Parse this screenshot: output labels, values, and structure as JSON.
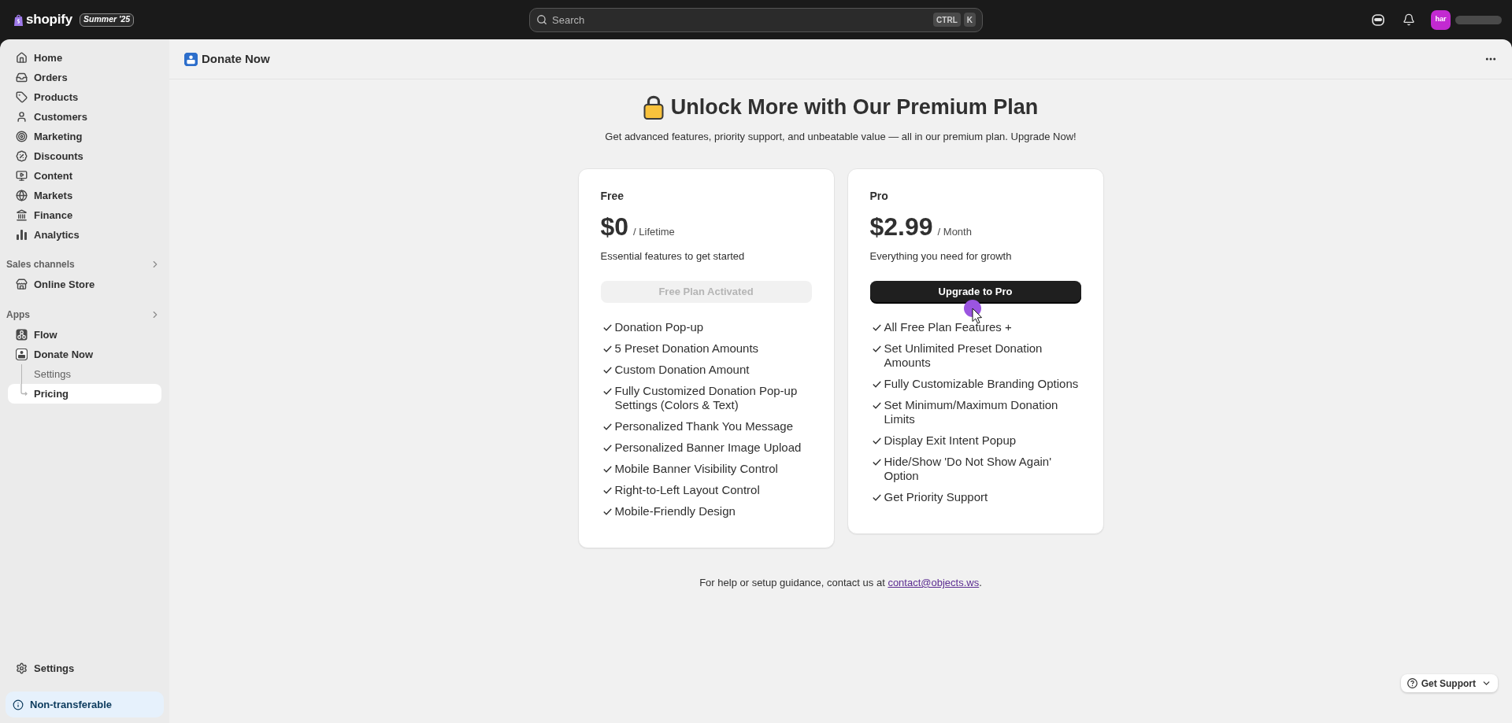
{
  "top_bar": {
    "logo": "shopify",
    "badge": "Summer '25",
    "search": {
      "placeholder": "Search",
      "shortcut_keys": [
        "CTRL",
        "K"
      ]
    },
    "avatar": "har"
  },
  "sidebar": {
    "main_items": [
      {
        "label": "Home",
        "selected": false
      },
      {
        "label": "Orders",
        "selected": false
      },
      {
        "label": "Products",
        "selected": false
      },
      {
        "label": "Customers",
        "selected": false
      },
      {
        "label": "Marketing",
        "selected": false
      },
      {
        "label": "Discounts",
        "selected": false
      },
      {
        "label": "Content",
        "selected": false
      },
      {
        "label": "Markets",
        "selected": false
      },
      {
        "label": "Finance",
        "selected": false
      },
      {
        "label": "Analytics",
        "selected": false
      }
    ],
    "sections": [
      {
        "title": "Sales channels",
        "items": [
          {
            "label": "Online Store",
            "selected": false
          }
        ]
      },
      {
        "title": "Apps",
        "items": [
          {
            "label": "Flow",
            "selected": false
          },
          {
            "label": "Donate Now",
            "selected": false,
            "children": [
              {
                "label": "Settings",
                "selected": false
              },
              {
                "label": "Pricing",
                "selected": true
              }
            ]
          }
        ]
      }
    ],
    "bottom_items": [
      {
        "label": "Settings",
        "selected": false
      }
    ],
    "notice": "Non-transferable"
  },
  "page_header": {
    "title": "Donate Now"
  },
  "hero": {
    "title": "Unlock More with Our Premium Plan",
    "subtitle": "Get advanced features, priority support, and unbeatable value — all in our premium plan. Upgrade Now!"
  },
  "plans": [
    {
      "name": "Free",
      "price": "$0",
      "period": "/ Lifetime",
      "description": "Essential features to get started",
      "button": {
        "label": "Free Plan Activated",
        "disabled": true
      },
      "features": [
        "Donation Pop-up",
        "5 Preset Donation Amounts",
        "Custom Donation Amount",
        "Fully Customized Donation Pop-up Settings (Colors & Text)",
        "Personalized Thank You Message",
        "Personalized Banner Image Upload",
        "Mobile Banner Visibility Control",
        "Right-to-Left Layout Control",
        "Mobile-Friendly Design"
      ]
    },
    {
      "name": "Pro",
      "price": "$2.99",
      "period": "/ Month",
      "description": "Everything you need for growth",
      "button": {
        "label": "Upgrade to Pro",
        "disabled": false
      },
      "features": [
        "All Free Plan Features +",
        "Set Unlimited Preset Donation Amounts",
        "Fully Customizable Branding Options",
        "Set Minimum/Maximum Donation Limits",
        "Display Exit Intent Popup",
        "Hide/Show 'Do Not Show Again' Option",
        "Get Priority Support"
      ]
    }
  ],
  "help_text": {
    "text": "For help or setup guidance, contact us at",
    "link": "contact@objects.ws",
    "end": "."
  },
  "support_button": {
    "label": "Get Support"
  }
}
